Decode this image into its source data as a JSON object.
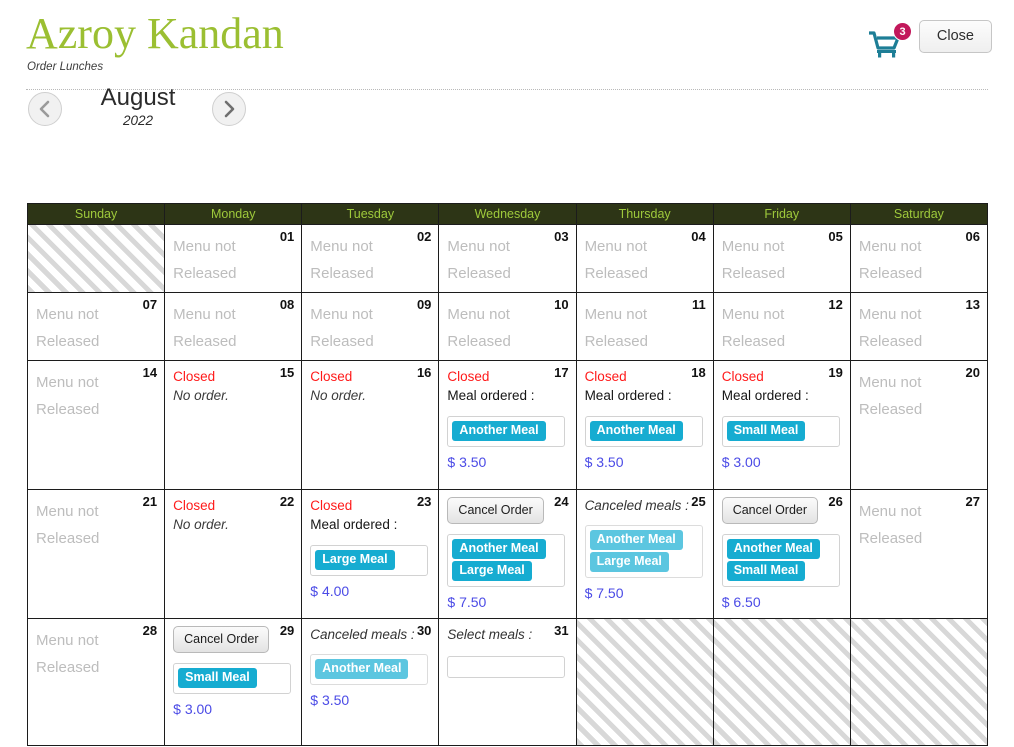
{
  "header": {
    "title": "Azroy Kandan",
    "subtitle": "Order Lunches",
    "cart_badge": "3",
    "cart_icon": "shopping-cart-icon",
    "close_label": "Close",
    "accent_green": "#9bbf32",
    "badge_color": "#C2185B",
    "cart_color": "#1D7E96"
  },
  "monthnav": {
    "prev_icon": "chevron-left-icon",
    "next_icon": "chevron-right-icon",
    "month": "August",
    "year": "2022"
  },
  "calendar": {
    "weekdays": [
      "Sunday",
      "Monday",
      "Tuesday",
      "Wednesday",
      "Thursday",
      "Friday",
      "Saturday"
    ],
    "header_bg": "#2d3516",
    "header_fg": "#9ec93b",
    "labels": {
      "menu_not_released_l1": "Menu not",
      "menu_not_released_l2": "Released",
      "closed": "Closed",
      "no_order": "No order.",
      "meal_ordered": "Meal ordered :",
      "canceled_meals": "Canceled meals :",
      "select_meals": "Select meals :",
      "cancel_order": "Cancel Order"
    },
    "weeks": [
      [
        {
          "type": "blank"
        },
        {
          "type": "unreleased",
          "day": "01"
        },
        {
          "type": "unreleased",
          "day": "02"
        },
        {
          "type": "unreleased",
          "day": "03"
        },
        {
          "type": "unreleased",
          "day": "04"
        },
        {
          "type": "unreleased",
          "day": "05"
        },
        {
          "type": "unreleased",
          "day": "06"
        }
      ],
      [
        {
          "type": "unreleased",
          "day": "07"
        },
        {
          "type": "unreleased",
          "day": "08"
        },
        {
          "type": "unreleased",
          "day": "09"
        },
        {
          "type": "unreleased",
          "day": "10"
        },
        {
          "type": "unreleased",
          "day": "11"
        },
        {
          "type": "unreleased",
          "day": "12"
        },
        {
          "type": "unreleased",
          "day": "13"
        }
      ],
      [
        {
          "type": "unreleased",
          "day": "14"
        },
        {
          "type": "closed-noorder",
          "day": "15"
        },
        {
          "type": "closed-noorder",
          "day": "16"
        },
        {
          "type": "closed-ordered",
          "day": "17",
          "meals": [
            "Another Meal"
          ],
          "price": "$ 3.50"
        },
        {
          "type": "closed-ordered",
          "day": "18",
          "meals": [
            "Another Meal"
          ],
          "price": "$ 3.50"
        },
        {
          "type": "closed-ordered",
          "day": "19",
          "meals": [
            "Small Meal"
          ],
          "price": "$ 3.00"
        },
        {
          "type": "unreleased",
          "day": "20"
        }
      ],
      [
        {
          "type": "unreleased",
          "day": "21"
        },
        {
          "type": "closed-noorder",
          "day": "22"
        },
        {
          "type": "closed-ordered",
          "day": "23",
          "meals": [
            "Large Meal"
          ],
          "price": "$ 4.00"
        },
        {
          "type": "cancelable",
          "day": "24",
          "meals": [
            "Another Meal",
            "Large Meal"
          ],
          "price": "$ 7.50"
        },
        {
          "type": "canceled",
          "day": "25",
          "meals": [
            "Another Meal",
            "Large Meal"
          ],
          "price": "$ 7.50"
        },
        {
          "type": "cancelable",
          "day": "26",
          "meals": [
            "Another Meal",
            "Small Meal"
          ],
          "price": "$ 6.50"
        },
        {
          "type": "unreleased",
          "day": "27"
        }
      ],
      [
        {
          "type": "unreleased",
          "day": "28"
        },
        {
          "type": "cancelable",
          "day": "29",
          "meals": [
            "Small Meal"
          ],
          "price": "$ 3.00"
        },
        {
          "type": "canceled",
          "day": "30",
          "meals": [
            "Another Meal"
          ],
          "price": "$ 3.50"
        },
        {
          "type": "selectable",
          "day": "31",
          "meals": [],
          "price": ""
        },
        {
          "type": "blank"
        },
        {
          "type": "blank"
        },
        {
          "type": "blank"
        }
      ]
    ]
  }
}
